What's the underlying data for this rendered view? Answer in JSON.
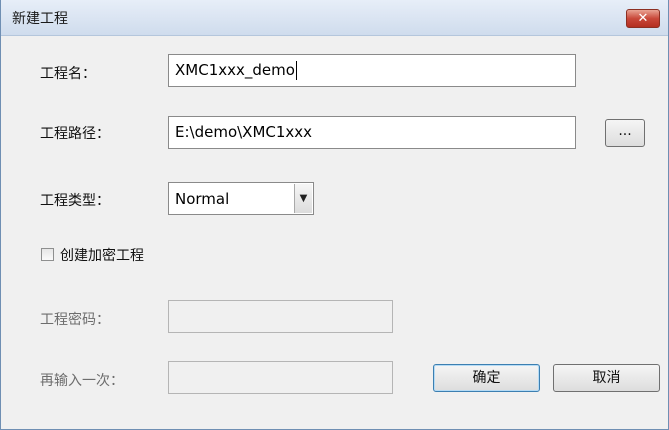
{
  "window": {
    "title": "新建工程",
    "close_glyph": "✕"
  },
  "form": {
    "project_name": {
      "label": "工程名：",
      "value": "XMC1xxx_demo"
    },
    "project_path": {
      "label": "工程路径：",
      "value": "E:\\demo\\XMC1xxx",
      "browse_label": "..."
    },
    "project_type": {
      "label": "工程类型：",
      "value": "Normal"
    },
    "encrypt_checkbox": {
      "label": "创建加密工程",
      "checked": false
    },
    "password": {
      "label": "工程密码：",
      "value": ""
    },
    "password_confirm": {
      "label": "再输入一次：",
      "value": ""
    }
  },
  "buttons": {
    "ok": "确定",
    "cancel": "取消"
  },
  "colors": {
    "title_gradient_top": "#e7eef8",
    "close_red": "#c9483a",
    "dialog_bg": "#f0f0f0"
  }
}
